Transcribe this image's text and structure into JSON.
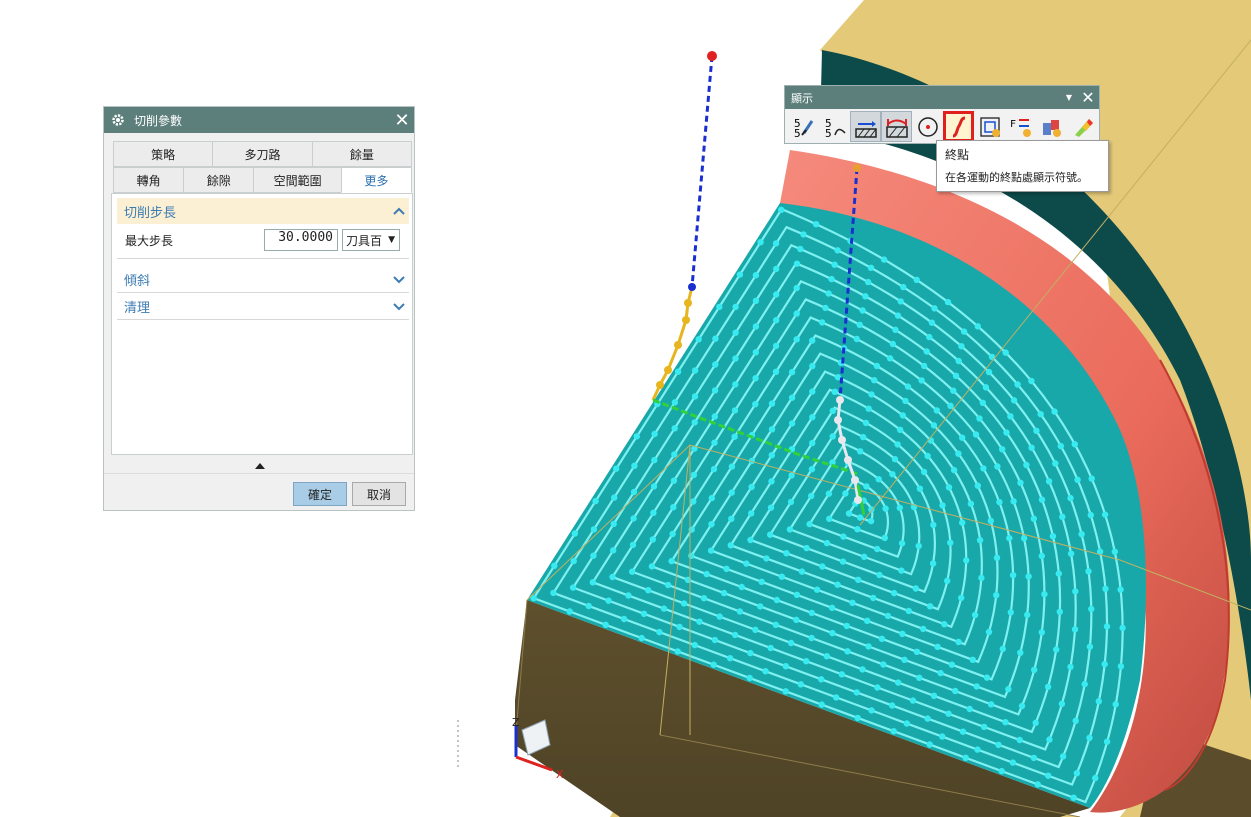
{
  "dialog": {
    "title": "切削參數",
    "tabs_row1": [
      "策略",
      "多刀路",
      "餘量"
    ],
    "tabs_row2": [
      "轉角",
      "餘隙",
      "空間範圍",
      "更多"
    ],
    "active_tab": "更多",
    "sections": {
      "step": {
        "label": "切削步長",
        "expanded": true
      },
      "tilt": {
        "label": "傾斜",
        "expanded": false
      },
      "cleanup": {
        "label": "清理",
        "expanded": false
      }
    },
    "max_step": {
      "label": "最大步長",
      "value": "30.0000",
      "unit": "刀具百"
    },
    "ok_label": "確定",
    "cancel_label": "取消"
  },
  "toolbar": {
    "title": "顯示",
    "icons": [
      "tool-display-icon",
      "path-display-icon",
      "cut-level-icon",
      "cut-region-icon",
      "start-point-icon",
      "end-point-icon",
      "tool-axis-icon",
      "feed-display-icon",
      "color-display-icon",
      "gradient-display-icon"
    ],
    "highlighted_icon": "end-point-icon"
  },
  "tooltip": {
    "title": "終點",
    "description": "在各運動的終點處顯示符號。"
  },
  "triad": {
    "z_label": "Z",
    "x_label": "X"
  },
  "colors": {
    "stock_top": "#e3c978",
    "stock_side": "#5b4d2c",
    "toolpath": "#18a8aa",
    "toolpath_line": "#7ff0f0",
    "fillet": "#f07060",
    "dark_wall": "#0d4a4a",
    "header": "#5c7f7c",
    "highlight": "#e0201c"
  }
}
